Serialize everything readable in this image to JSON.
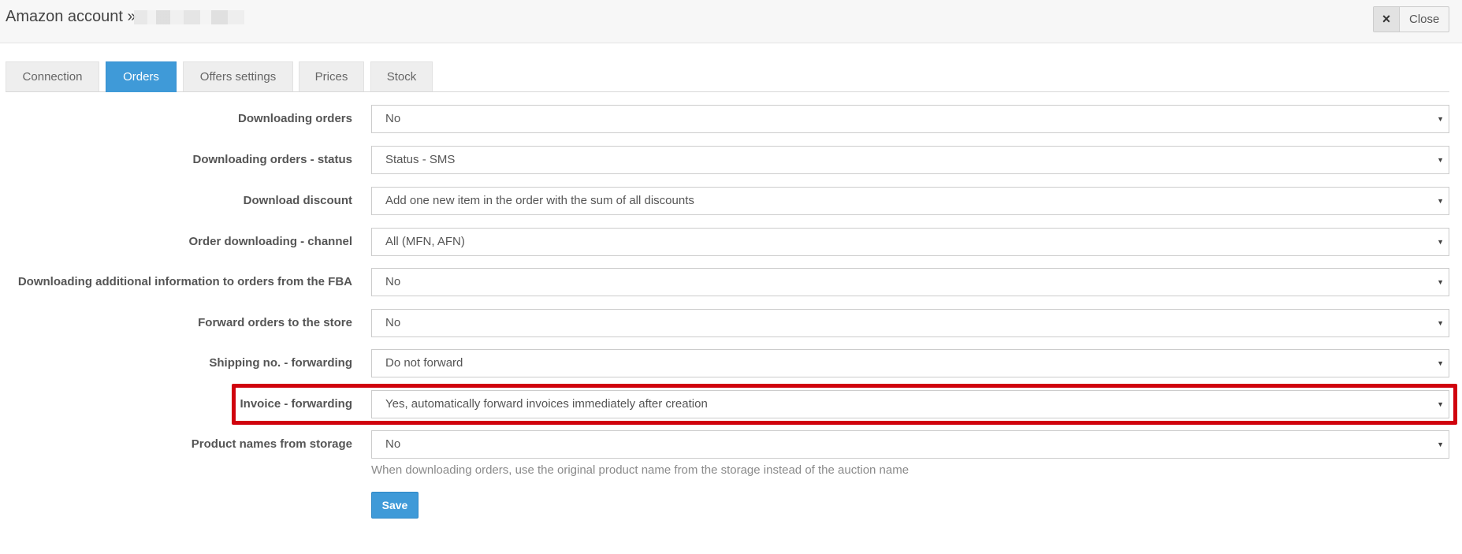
{
  "header": {
    "title": "Amazon account »",
    "close_label": "Close",
    "close_icon": "×"
  },
  "tabs": [
    {
      "label": "Connection",
      "active": false
    },
    {
      "label": "Orders",
      "active": true
    },
    {
      "label": "Offers settings",
      "active": false
    },
    {
      "label": "Prices",
      "active": false
    },
    {
      "label": "Stock",
      "active": false
    }
  ],
  "form": {
    "fields": [
      {
        "label": "Downloading orders",
        "value": "No"
      },
      {
        "label": "Downloading orders - status",
        "value": "Status - SMS"
      },
      {
        "label": "Download discount",
        "value": "Add one new item in the order with the sum of all discounts"
      },
      {
        "label": "Order downloading - channel",
        "value": "All (MFN, AFN)"
      },
      {
        "label": "Downloading additional information to orders from the FBA",
        "value": "No"
      },
      {
        "label": "Forward orders to the store",
        "value": "No"
      },
      {
        "label": "Shipping no. - forwarding",
        "value": "Do not forward"
      },
      {
        "label": "Invoice - forwarding",
        "value": "Yes, automatically forward invoices immediately after creation"
      },
      {
        "label": "Product names from storage",
        "value": "No"
      }
    ],
    "help_text": "When downloading orders, use the original product name from the storage instead of the auction name",
    "save_label": "Save"
  },
  "caret_icon": "▼",
  "colors": {
    "accent": "#3f9ad8",
    "highlight": "#d0020d"
  }
}
